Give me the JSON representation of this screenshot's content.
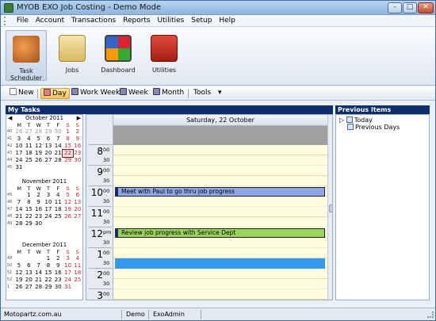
{
  "window": {
    "title": "MYOB EXO Job Costing - Demo Mode",
    "min": "–",
    "max": "□",
    "close": "✕"
  },
  "menu": [
    "File",
    "Account",
    "Transactions",
    "Reports",
    "Utilities",
    "Setup",
    "Help"
  ],
  "ribbon": {
    "buttons": [
      {
        "label": "Task Scheduler",
        "icon": "task-scheduler-icon",
        "selected": true
      },
      {
        "label": "Jobs",
        "icon": "jobs-icon",
        "selected": false
      },
      {
        "label": "Dashboard",
        "icon": "dashboard-icon",
        "selected": false
      },
      {
        "label": "Utilities",
        "icon": "utilities-icon",
        "selected": false
      }
    ]
  },
  "toolbar": {
    "new": "New",
    "day": "Day",
    "work_week": "Work Week",
    "week": "Week",
    "month": "Month",
    "tools": "Tools",
    "tools_arrow": "▾"
  },
  "my_tasks": {
    "title": "My Tasks"
  },
  "calendar": {
    "months": [
      {
        "name": "October 2011",
        "prev": "◀",
        "next": "▶",
        "dow": [
          "M",
          "T",
          "W",
          "T",
          "F",
          "S",
          "S"
        ],
        "weeks": [
          {
            "wn": "40",
            "days": [
              "26",
              "27",
              "28",
              "29",
              "30",
              "1",
              "2"
            ]
          },
          {
            "wn": "41",
            "days": [
              "3",
              "4",
              "5",
              "6",
              "7",
              "8",
              "9"
            ]
          },
          {
            "wn": "42",
            "days": [
              "10",
              "11",
              "12",
              "13",
              "14",
              "15",
              "16"
            ]
          },
          {
            "wn": "43",
            "days": [
              "17",
              "18",
              "19",
              "20",
              "21",
              "22",
              "23"
            ]
          },
          {
            "wn": "44",
            "days": [
              "24",
              "25",
              "26",
              "27",
              "28",
              "29",
              "30"
            ]
          },
          {
            "wn": "45",
            "days": [
              "31",
              "",
              "",
              "",
              "",
              "",
              ""
            ]
          }
        ]
      },
      {
        "name": "November 2011",
        "dow": [
          "M",
          "T",
          "W",
          "T",
          "F",
          "S",
          "S"
        ],
        "weeks": [
          {
            "wn": "45",
            "days": [
              "",
              "1",
              "2",
              "3",
              "4",
              "5",
              "6"
            ]
          },
          {
            "wn": "46",
            "days": [
              "7",
              "8",
              "9",
              "10",
              "11",
              "12",
              "13"
            ]
          },
          {
            "wn": "47",
            "days": [
              "14",
              "15",
              "16",
              "17",
              "18",
              "19",
              "20"
            ]
          },
          {
            "wn": "48",
            "days": [
              "21",
              "22",
              "23",
              "24",
              "25",
              "26",
              "27"
            ]
          },
          {
            "wn": "49",
            "days": [
              "28",
              "29",
              "30",
              "",
              "",
              "",
              ""
            ]
          }
        ]
      },
      {
        "name": "December 2011",
        "next": "",
        "dow": [
          "M",
          "T",
          "W",
          "T",
          "F",
          "S",
          "S"
        ],
        "weeks": [
          {
            "wn": "49",
            "days": [
              "",
              "",
              "",
              "1",
              "2",
              "3",
              "4"
            ]
          },
          {
            "wn": "50",
            "days": [
              "5",
              "6",
              "7",
              "8",
              "9",
              "10",
              "11"
            ]
          },
          {
            "wn": "51",
            "days": [
              "12",
              "13",
              "14",
              "15",
              "16",
              "17",
              "18"
            ]
          },
          {
            "wn": "52",
            "days": [
              "19",
              "20",
              "21",
              "22",
              "23",
              "24",
              "25"
            ]
          },
          {
            "wn": "1",
            "days": [
              "26",
              "27",
              "28",
              "29",
              "30",
              "31",
              ""
            ]
          }
        ]
      }
    ],
    "today": "22"
  },
  "schedule": {
    "day_header": "Saturday, 22 October",
    "hours": [
      {
        "h": "8",
        "m1": "00",
        "m2": "30"
      },
      {
        "h": "9",
        "m1": "00",
        "m2": "30"
      },
      {
        "h": "10",
        "m1": "00",
        "m2": "30"
      },
      {
        "h": "11",
        "m1": "00",
        "m2": "30"
      },
      {
        "h": "12",
        "m1": "pm",
        "m2": "30"
      },
      {
        "h": "1",
        "m1": "00",
        "m2": "30"
      },
      {
        "h": "2",
        "m1": "00",
        "m2": "30"
      },
      {
        "h": "3",
        "m1": "00",
        "m2": "30"
      }
    ],
    "appointments": [
      {
        "text": "Meet with Paul to go thru job progress",
        "color": "#8ea6e6",
        "time": "10:00"
      },
      {
        "text": "Review job progress with Service Dept",
        "color": "#9bd45c",
        "time": "12:00"
      }
    ],
    "selected_slot": "1:30",
    "colors": {
      "selected": "#3399ee",
      "workday": "#fffde0"
    }
  },
  "previous_items": {
    "title": "Previous Items",
    "items": [
      {
        "label": "Today",
        "expander": "▷"
      },
      {
        "label": "Previous Days"
      }
    ]
  },
  "status": {
    "site": "Motopartz.com.au",
    "mode": "Demo",
    "user": "ExoAdmin"
  }
}
